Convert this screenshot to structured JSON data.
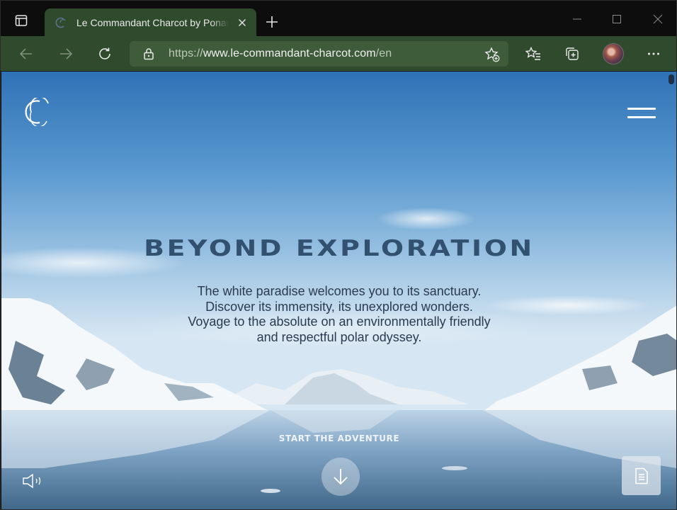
{
  "browser": {
    "tab": {
      "title": "Le Commandant Charcot by Ponant",
      "favicon": "ponant-logo-icon"
    },
    "address_bar": {
      "url_prefix": "https://",
      "url_domain": "www.le-commandant-charcot.com",
      "url_path": "/en"
    },
    "icons": {
      "tab_actions": "tab-actions-icon",
      "new_tab": "plus-icon",
      "minimize": "minimize-icon",
      "maximize": "maximize-icon",
      "close": "close-icon",
      "back": "arrow-left-icon",
      "forward": "arrow-right-icon",
      "refresh": "refresh-icon",
      "lock": "lock-icon",
      "add_favorite": "star-plus-icon",
      "favorites": "favorites-icon",
      "collections": "collections-icon",
      "profile": "avatar",
      "more": "more-icon"
    },
    "colors": {
      "theme": "#2f4a2c",
      "address_bar": "#3e5b3a",
      "titlebar": "#0d0d0d"
    }
  },
  "page": {
    "headline": "BEYOND EXPLORATION",
    "intro_lines": [
      "The white paradise welcomes you to its sanctuary.",
      "Discover its immensity, its unexplored wonders.",
      "Voyage to the absolute on an environmentally friendly",
      "and respectful polar odyssey."
    ],
    "cta": "START THE ADVENTURE",
    "icons": {
      "logo": "ponant-logo-icon",
      "menu": "hamburger-menu-icon",
      "scroll_down": "arrow-down-icon",
      "sound": "speaker-icon",
      "brochure": "document-icon"
    },
    "colors": {
      "headline": "#32506f",
      "intro_text": "#2b3b4f",
      "sky_top": "#2f72b6",
      "snow": "#f4f8fb"
    }
  }
}
